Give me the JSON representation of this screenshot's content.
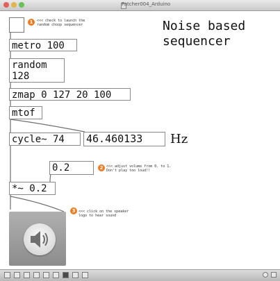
{
  "window": {
    "title": "Patcher004_Arduino"
  },
  "toggle": {
    "comment": "<<< check to launch the\nrandom choop sequencer"
  },
  "title": {
    "line1": "Noise based",
    "line2": "sequencer"
  },
  "objects": {
    "metro": "metro 100",
    "random_line1": "random",
    "random_line2": "128",
    "zmap": "zmap 0 127 20 100",
    "mtof": "mtof",
    "cycle": "cycle~ 74",
    "freq_number": "46.460133",
    "freq_unit": "Hz",
    "gain_number": "0.2",
    "multiply": "*~ 0.2"
  },
  "annotations": {
    "step1": "1",
    "step2": "2",
    "step3": "3",
    "volume_comment": "<<< adjust volume from 0. to 1.\nDon't play too loud!!",
    "speaker_comment": "<<< click on the speaker\nlogo to hear sound"
  },
  "icons": {
    "speaker": "speaker-icon",
    "toolbar": [
      "lock-icon",
      "new-object-icon",
      "message-icon",
      "comment-icon",
      "number-icon",
      "toggle-icon",
      "bang-icon",
      "slider-icon",
      "panel-icon"
    ]
  }
}
